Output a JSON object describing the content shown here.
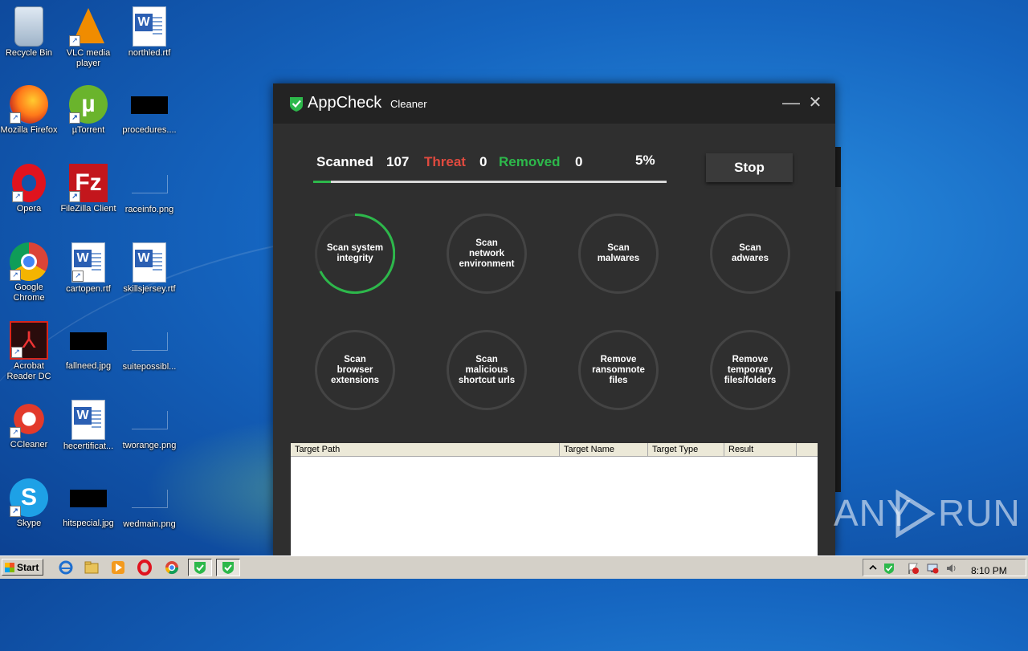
{
  "desktop": {
    "icons": [
      {
        "label": "Recycle Bin"
      },
      {
        "label": "VLC media player"
      },
      {
        "label": "northled.rtf"
      },
      {
        "label": "Mozilla Firefox"
      },
      {
        "label": "µTorrent"
      },
      {
        "label": "procedures...."
      },
      {
        "label": "Opera"
      },
      {
        "label": "FileZilla Client"
      },
      {
        "label": "raceinfo.png"
      },
      {
        "label": "Google Chrome"
      },
      {
        "label": "cartopen.rtf"
      },
      {
        "label": "skillsjersey.rtf"
      },
      {
        "label": "Acrobat Reader DC"
      },
      {
        "label": "fallneed.jpg"
      },
      {
        "label": "suitepossibl..."
      },
      {
        "label": "CCleaner"
      },
      {
        "label": "hecertificat..."
      },
      {
        "label": "tworange.png"
      },
      {
        "label": "Skype"
      },
      {
        "label": "hitspecial.jpg"
      },
      {
        "label": "wedmain.png"
      }
    ]
  },
  "app": {
    "title": "AppCheck",
    "subtitle": "Cleaner",
    "minimize_glyph": "—",
    "close_glyph": "✕",
    "stats": {
      "scanned_label": "Scanned",
      "scanned_value": "107",
      "threat_label": "Threat",
      "threat_value": "0",
      "removed_label": "Removed",
      "removed_value": "0",
      "percent": "5%",
      "progress_fraction": 0.05
    },
    "stop_label": "Stop",
    "scan_buttons": [
      {
        "label": "Scan system integrity",
        "active": true
      },
      {
        "label": "Scan network environment",
        "active": false
      },
      {
        "label": "Scan malwares",
        "active": false
      },
      {
        "label": "Scan adwares",
        "active": false
      },
      {
        "label": "Scan browser extensions",
        "active": false
      },
      {
        "label": "Scan malicious shortcut urls",
        "active": false
      },
      {
        "label": "Remove ransomnote files",
        "active": false
      },
      {
        "label": "Remove temporary files/folders",
        "active": false
      }
    ],
    "table": {
      "columns": [
        "Target Path",
        "Target Name",
        "Target Type",
        "Result"
      ]
    },
    "colors": {
      "accent_green": "#2db84b",
      "threat_red": "#e04a3f",
      "removed_green": "#2db84b"
    }
  },
  "watermark": {
    "text_left": "ANY",
    "text_right": "RUN"
  },
  "taskbar": {
    "start_label": "Start",
    "clock": "8:10 PM"
  }
}
